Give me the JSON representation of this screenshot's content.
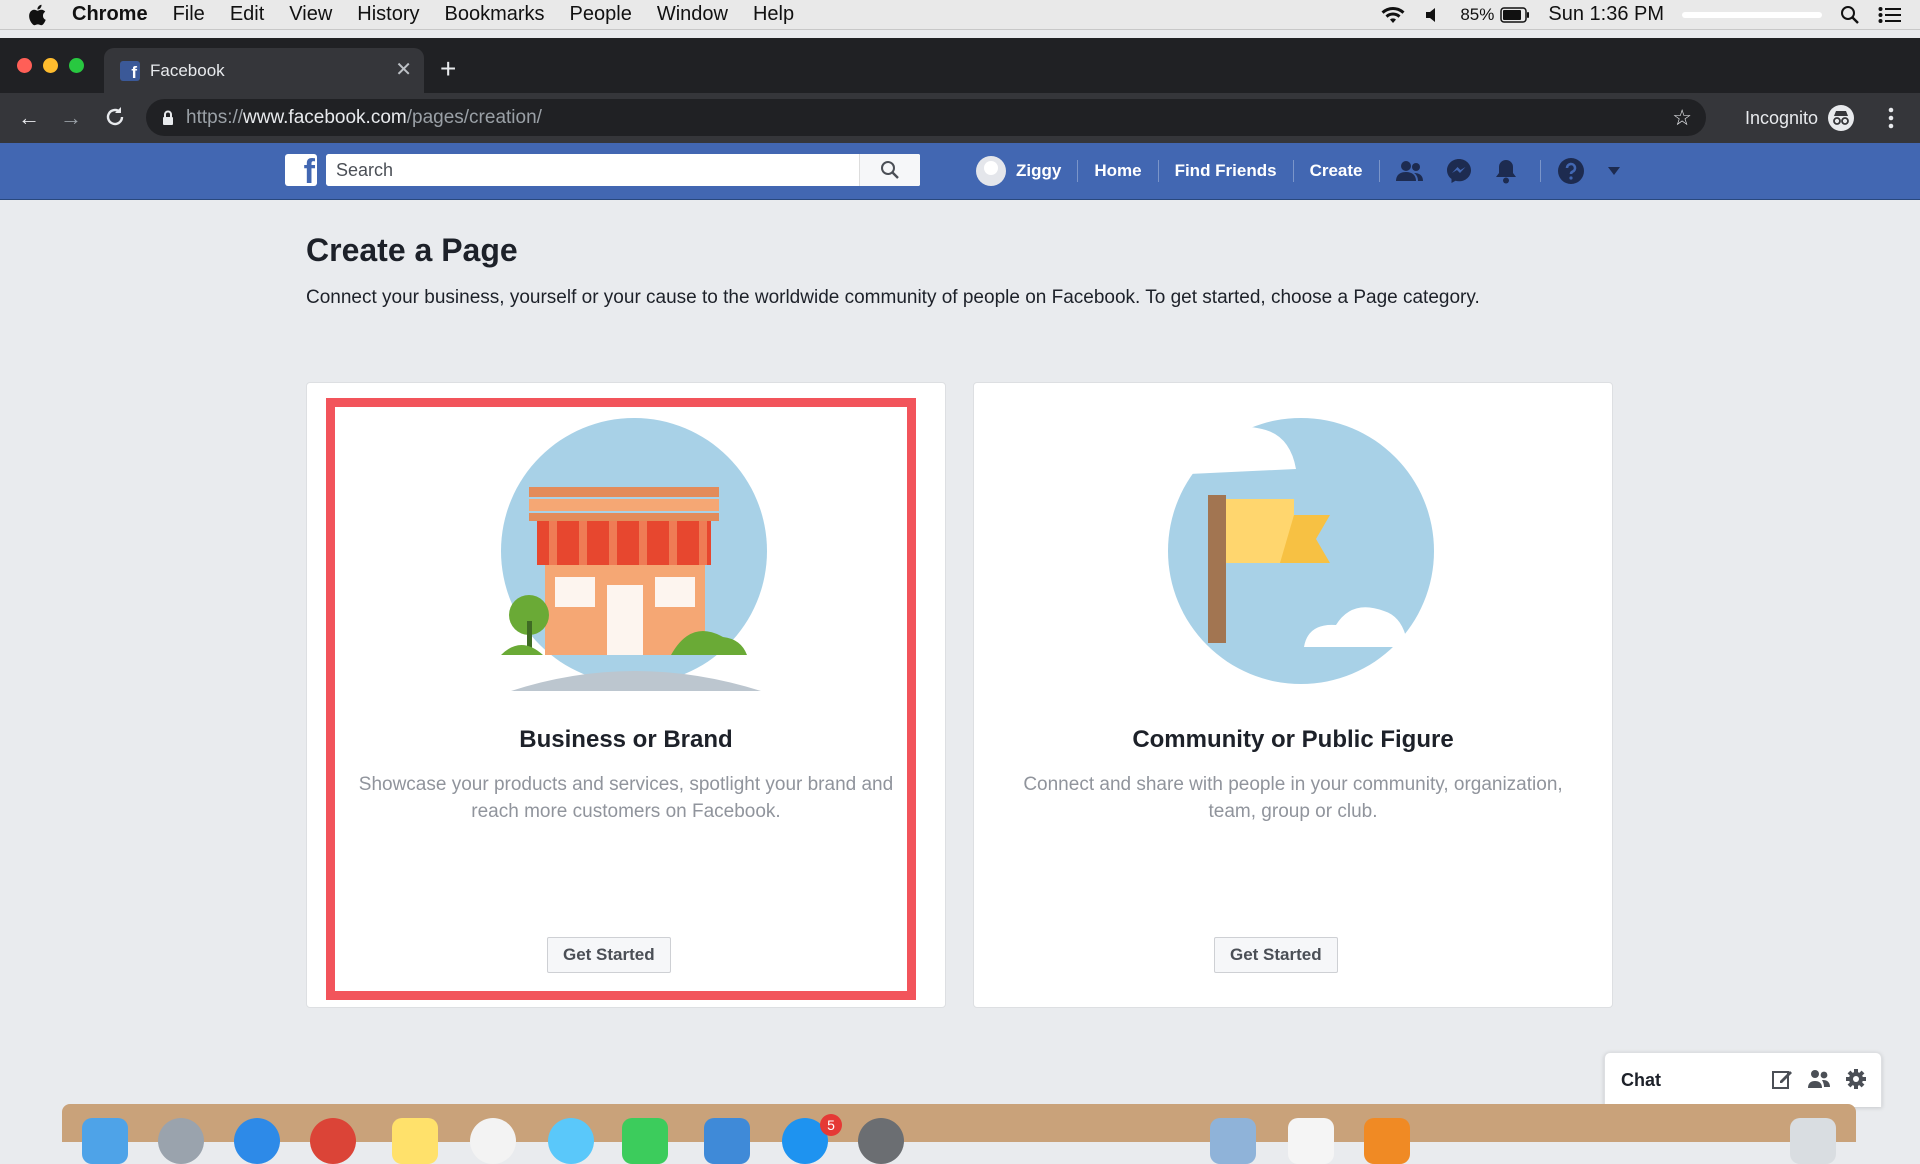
{
  "menubar": {
    "app": "Chrome",
    "items": [
      "File",
      "Edit",
      "View",
      "History",
      "Bookmarks",
      "People",
      "Window",
      "Help"
    ],
    "battery": "85%",
    "clock": "Sun 1:36 PM"
  },
  "browser": {
    "tab_title": "Facebook",
    "url_scheme": "https://",
    "url_host": "www.facebook.com",
    "url_path": "/pages/creation/",
    "incognito_label": "Incognito"
  },
  "fb": {
    "search_placeholder": "Search",
    "user_name": "Ziggy",
    "nav": {
      "home": "Home",
      "find_friends": "Find Friends",
      "create": "Create"
    }
  },
  "page": {
    "title": "Create a Page",
    "subtitle": "Connect your business, yourself or your cause to the worldwide community of people on Facebook. To get started, choose a Page category.",
    "cards": [
      {
        "title": "Business or Brand",
        "description": "Showcase your products and services, spotlight your brand and reach more customers on Facebook.",
        "button": "Get Started"
      },
      {
        "title": "Community or Public Figure",
        "description": "Connect and share with people in your community, organization, team, group or club.",
        "button": "Get Started"
      }
    ]
  },
  "chat": {
    "label": "Chat"
  },
  "dock": {
    "badge": "5"
  },
  "colors": {
    "fb_blue": "#4267b2",
    "highlight": "#f2545b",
    "chrome_dark": "#35363a"
  }
}
